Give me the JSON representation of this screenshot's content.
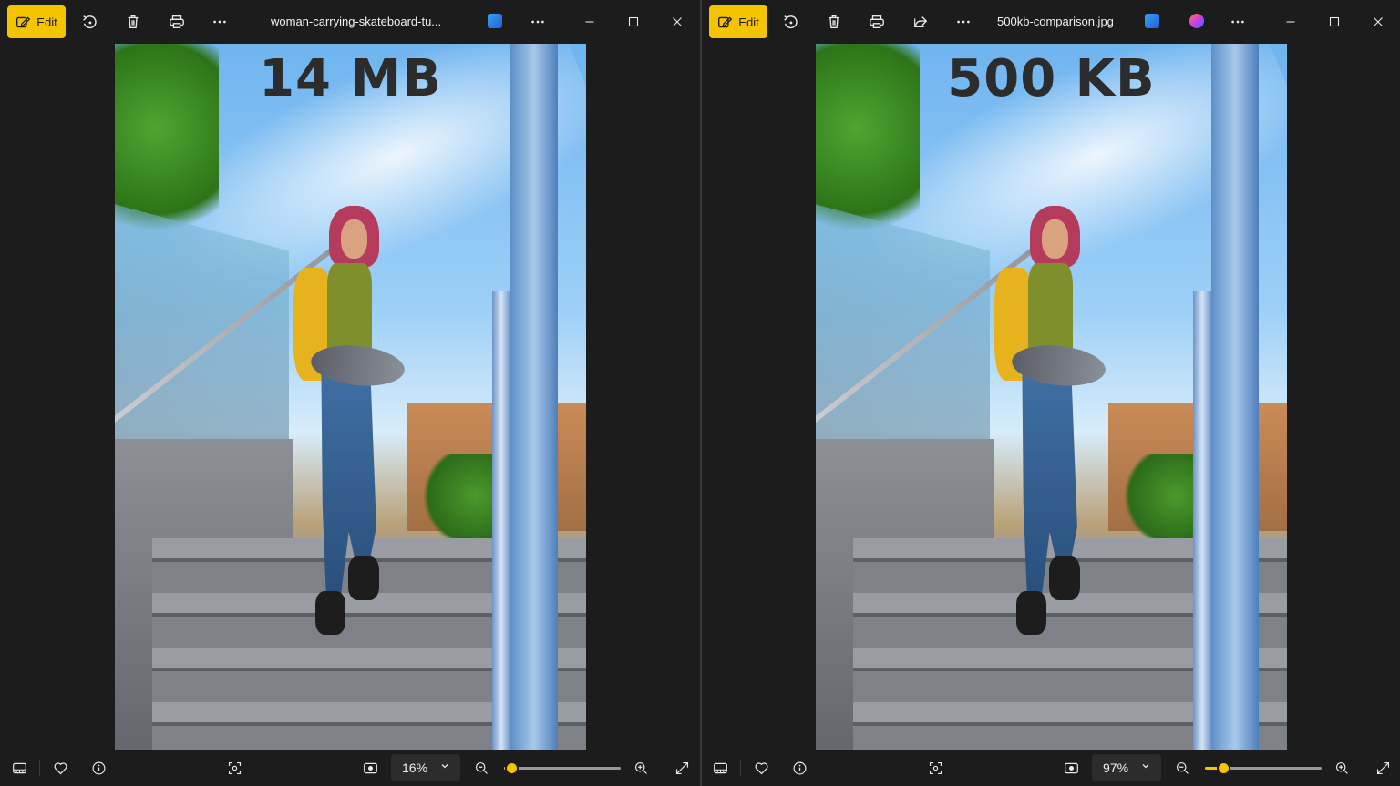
{
  "colors": {
    "accent": "#f5c400",
    "background": "#1c1c1c",
    "text": "#f0f0f0"
  },
  "windows": [
    {
      "edit_label": "Edit",
      "filename": "woman-carrying-skateboard-tu...",
      "overlay_text": "14 MB",
      "zoom_value": "16%",
      "zoom_fraction": 0.06,
      "toolbar_icons": [
        "rotate-icon",
        "delete-icon",
        "print-icon",
        "more-icon"
      ],
      "statusbar_icons": [
        "filmstrip-icon",
        "favorite-icon",
        "info-icon",
        "focus-icon",
        "actual-size-icon",
        "zoom-out-icon",
        "zoom-in-icon",
        "fullscreen-icon"
      ]
    },
    {
      "edit_label": "Edit",
      "filename": "500kb-comparison.jpg",
      "overlay_text": "500 KB",
      "zoom_value": "97%",
      "zoom_fraction": 0.16,
      "toolbar_icons": [
        "rotate-icon",
        "delete-icon",
        "print-icon",
        "share-icon",
        "more-icon"
      ],
      "statusbar_icons": [
        "filmstrip-icon",
        "favorite-icon",
        "info-icon",
        "focus-icon",
        "actual-size-icon",
        "zoom-out-icon",
        "zoom-in-icon",
        "fullscreen-icon"
      ]
    }
  ]
}
